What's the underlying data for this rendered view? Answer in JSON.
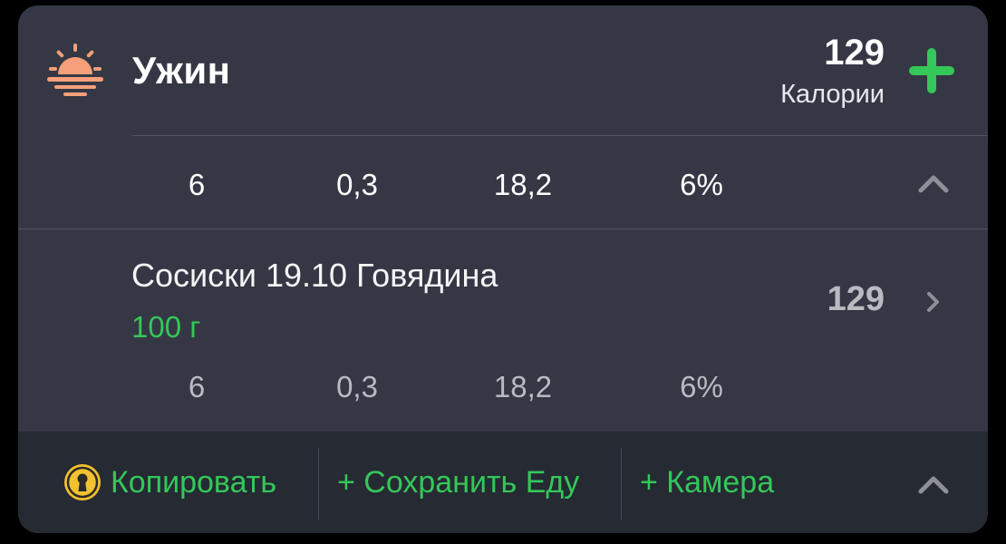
{
  "meal": {
    "title": "Ужин",
    "calories_value": "129",
    "calories_label": "Калории",
    "summary": [
      "6",
      "0,3",
      "18,2",
      "6%"
    ]
  },
  "food_item": {
    "name": "Сосиски 19.10 Говядина",
    "portion": "100 г",
    "calories": "129",
    "macros": [
      "6",
      "0,3",
      "18,2",
      "6%"
    ]
  },
  "footer": {
    "copy_label": "Копировать",
    "save_food_label": "+ Сохранить Еду",
    "camera_label": "+ Камера"
  },
  "colors": {
    "card_bg": "#353844",
    "footer_bg": "#262a33",
    "accent_green": "#34c759",
    "sunset_orange": "#f5a07a",
    "lock_gold": "#f2c12e"
  },
  "icons": {
    "meal": "sunset-icon",
    "add": "plus-icon",
    "collapse": "chevron-up-icon",
    "open": "chevron-right-icon",
    "copy": "lock-icon"
  }
}
